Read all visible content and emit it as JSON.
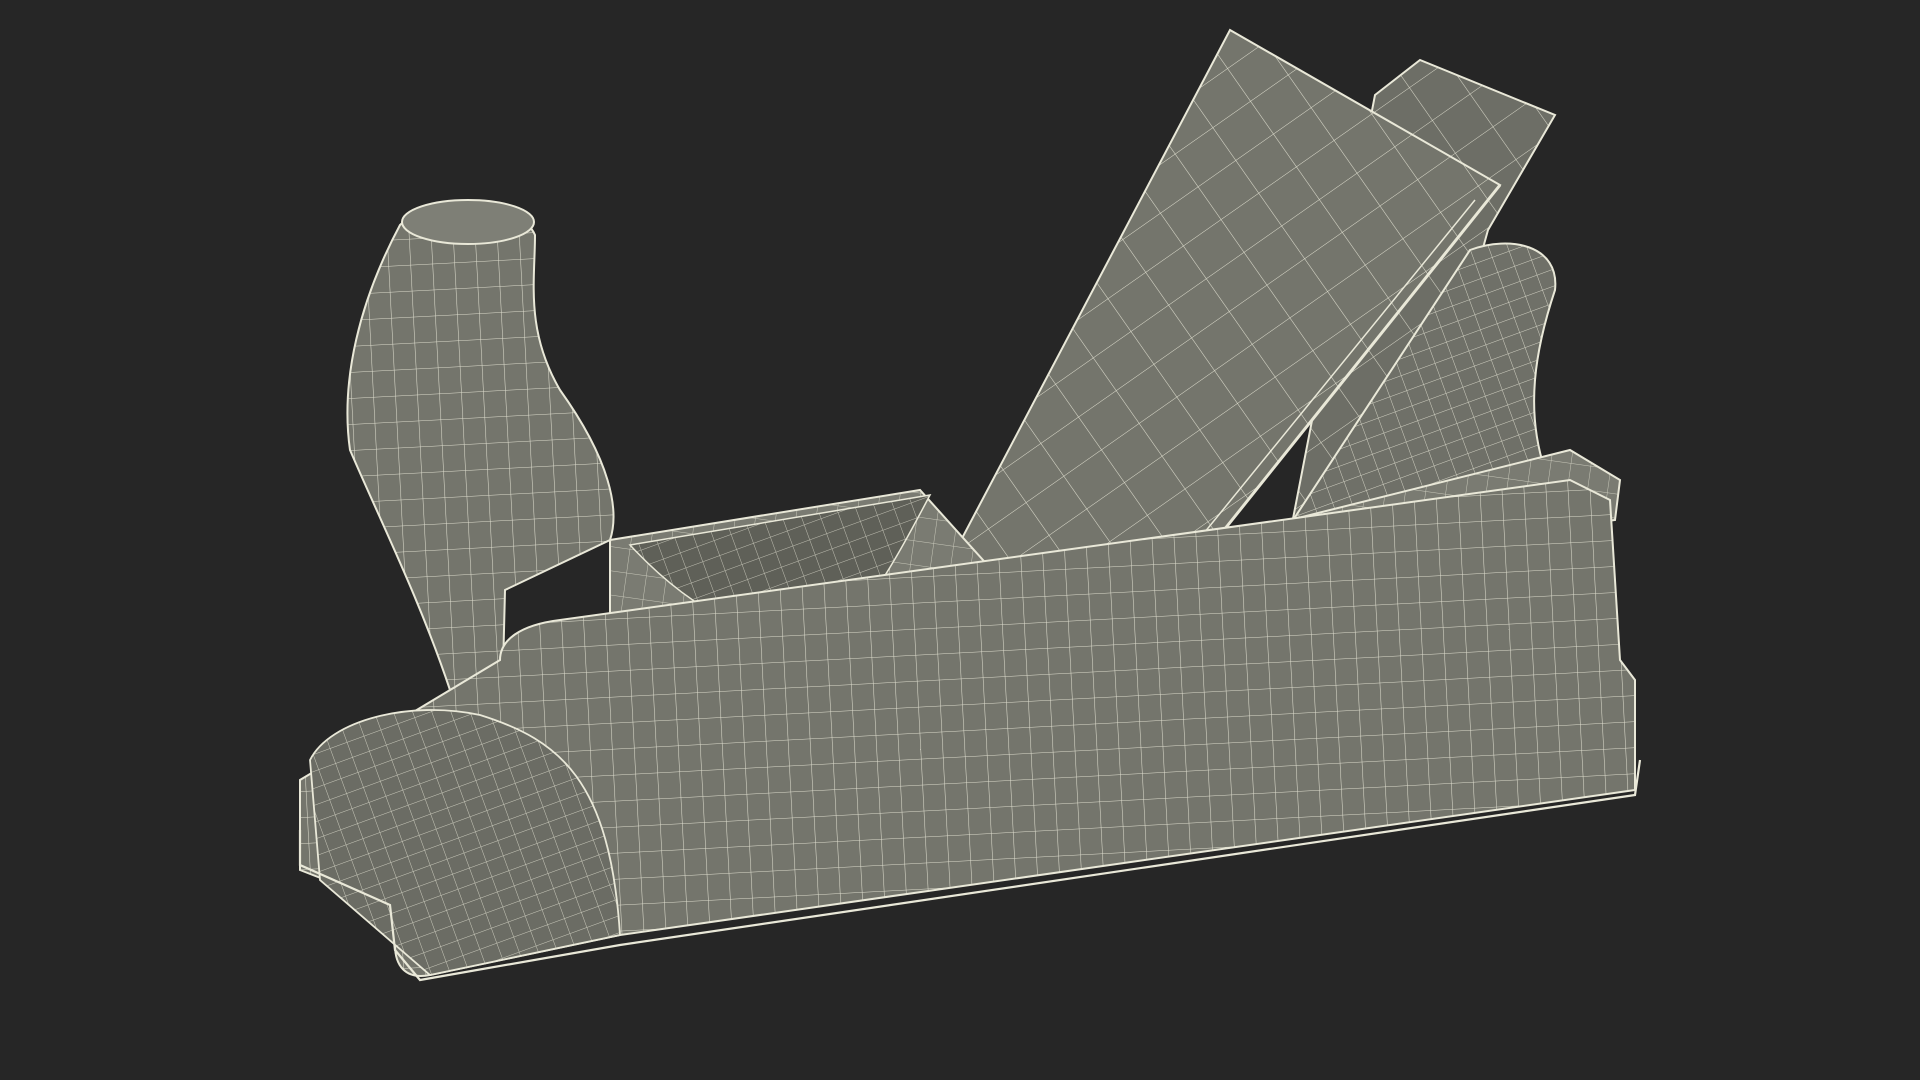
{
  "scene": {
    "subject": "wood-plane-wireframe",
    "background_color": "#262626",
    "surface_color": "#74756c",
    "surface_shadow_color": "#5f6058",
    "surface_highlight_color": "#85867c",
    "wire_color": "#e9e8d8"
  }
}
